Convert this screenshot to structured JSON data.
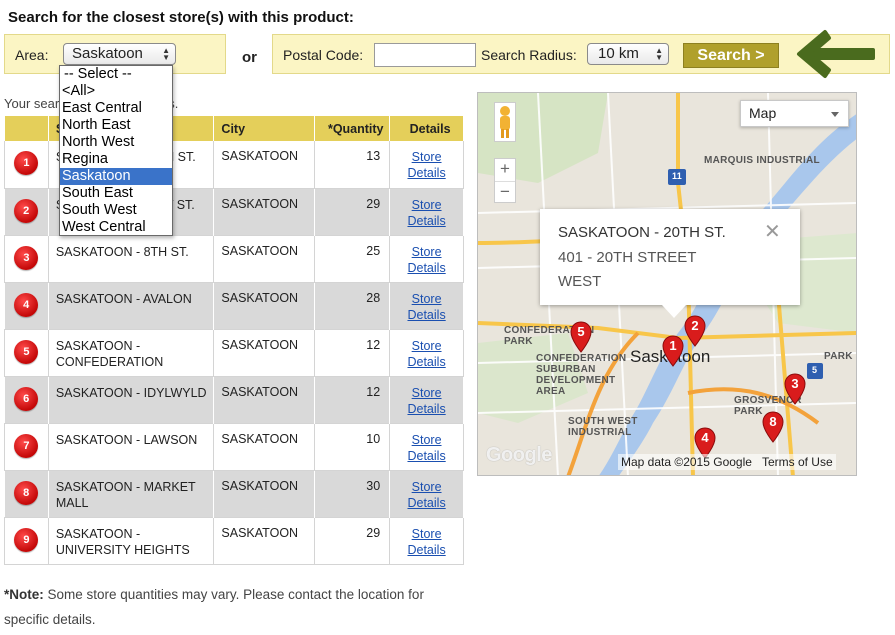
{
  "search": {
    "headline": "Search for the closest store(s) with this product:",
    "area_label": "Area:",
    "area_value": "Saskatoon",
    "or_label": "or",
    "postal_label": "Postal Code:",
    "postal_value": "",
    "radius_label": "Search Radius:",
    "radius_value": "10 km",
    "search_button": "Search >"
  },
  "area_dropdown": {
    "options": [
      "-- Select --",
      "<All>",
      "East Central",
      "North East",
      "North West",
      "Regina",
      "Saskatoon",
      "South East",
      "South West",
      "West Central"
    ],
    "selected": "Saskatoon"
  },
  "results_text": "Your search returned 9 stores.",
  "table": {
    "headers": {
      "store": "Store",
      "city": "City",
      "quantity": "*Quantity",
      "details": "Details"
    },
    "details_link_line1": "Store",
    "details_link_line2": "Details",
    "rows": [
      {
        "num": "1",
        "name": "SASKATOON - 20TH ST.",
        "city": "SASKATOON",
        "qty": "13"
      },
      {
        "num": "2",
        "name": "SASKATOON - 51ST ST.",
        "city": "SASKATOON",
        "qty": "29"
      },
      {
        "num": "3",
        "name": "SASKATOON - 8TH ST.",
        "city": "SASKATOON",
        "qty": "25"
      },
      {
        "num": "4",
        "name": "SASKATOON - AVALON",
        "city": "SASKATOON",
        "qty": "28"
      },
      {
        "num": "5",
        "name": "SASKATOON - CONFEDERATION",
        "city": "SASKATOON",
        "qty": "12"
      },
      {
        "num": "6",
        "name": "SASKATOON - IDYLWYLD",
        "city": "SASKATOON",
        "qty": "12"
      },
      {
        "num": "7",
        "name": "SASKATOON - LAWSON",
        "city": "SASKATOON",
        "qty": "10"
      },
      {
        "num": "8",
        "name": "SASKATOON - MARKET MALL",
        "city": "SASKATOON",
        "qty": "30"
      },
      {
        "num": "9",
        "name": "SASKATOON - UNIVERSITY HEIGHTS",
        "city": "SASKATOON",
        "qty": "29"
      }
    ]
  },
  "note": {
    "bold": "*Note:",
    "text": " Some store quantities may vary. Please contact the location for specific details."
  },
  "map": {
    "type_label": "Map",
    "zoom_in": "+",
    "zoom_out": "−",
    "info_title": "SASKATOON - 20TH ST.",
    "info_line1": "401 - 20TH STREET",
    "info_line2": "WEST",
    "info_close": "✕",
    "city_label": "Saskatoon",
    "labels": {
      "marquis": "MARQUIS INDUSTRIAL",
      "confederation_park": "CONFEDERATION PARK",
      "confederation_suburban": "CONFEDERATION SUBURBAN DEVELOPMENT AREA",
      "grosvenor": "GROSVENOR PARK",
      "southwest": "SOUTH WEST INDUSTRIAL",
      "park": "PARK"
    },
    "highway_11": "11",
    "highway_5": "5",
    "google": "Google",
    "map_data": "Map data ©2015 Google",
    "terms": "Terms of Use",
    "pins": [
      "1",
      "2",
      "3",
      "4",
      "5",
      "8"
    ]
  },
  "colors": {
    "header_yellow": "#e4cf5a",
    "panel_yellow": "#fbf5c4",
    "button_olive": "#b0a02c",
    "arrow_green": "#4a6b1e",
    "badge_red": "#d40d0d",
    "link_blue": "#1a4fb0"
  }
}
